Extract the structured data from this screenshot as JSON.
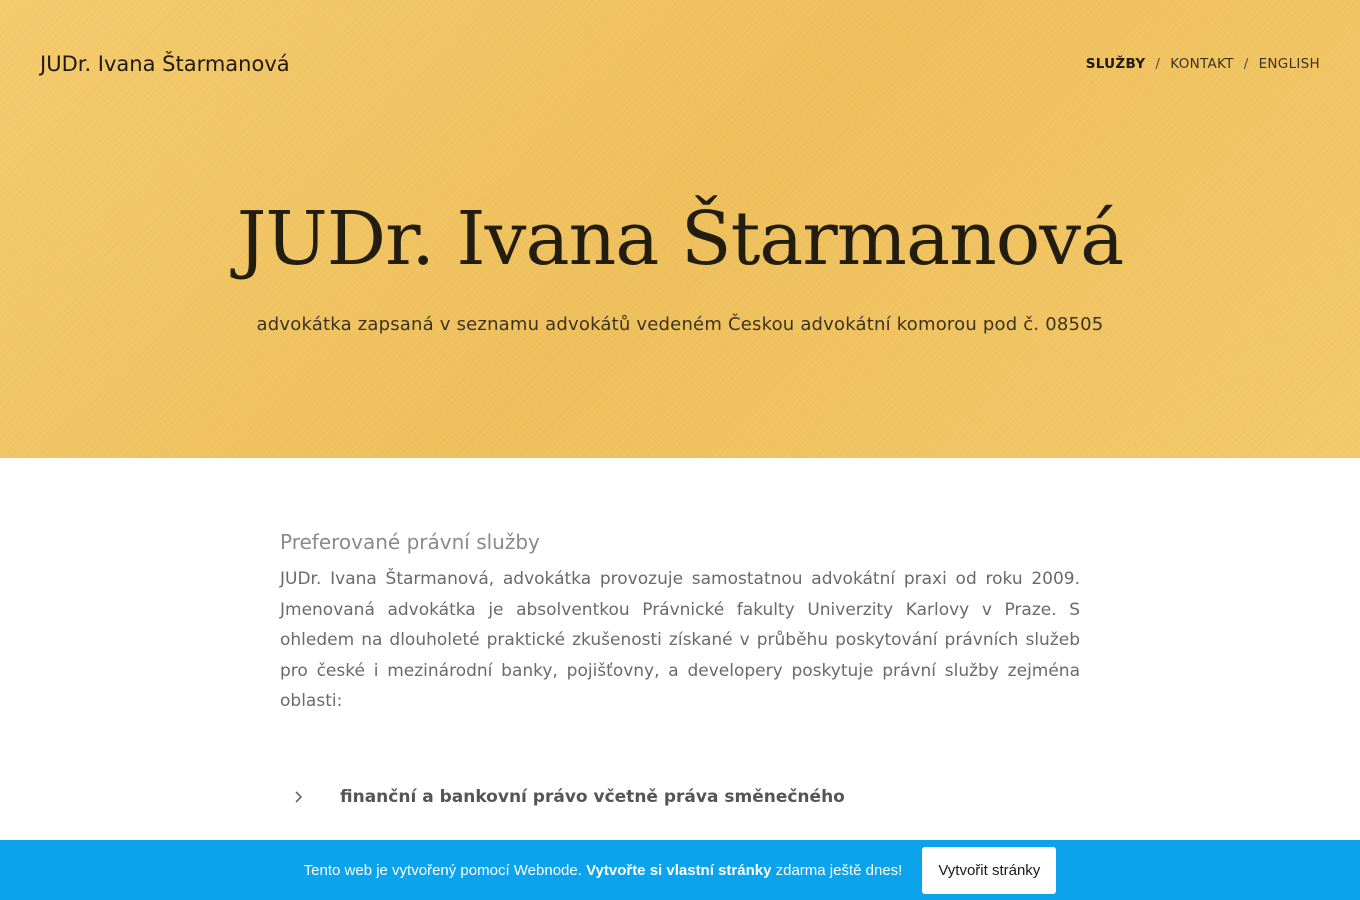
{
  "header": {
    "brand": "JUDr. Ivana Štarmanová",
    "nav": [
      {
        "label": "SLUŽBY",
        "active": true
      },
      {
        "label": "KONTAKT",
        "active": false
      },
      {
        "label": "ENGLISH",
        "active": false
      }
    ],
    "separator": "/"
  },
  "hero": {
    "title": "JUDr. Ivana Štarmanová",
    "subtitle": "advokátka zapsaná v seznamu advokátů vedeném Českou advokátní komorou pod č. 08505",
    "background_color": "#f0c461"
  },
  "main": {
    "section_title": "Preferované právní služby",
    "section_text": "JUDr. Ivana Štarmanová, advokátka provozuje samostatnou advokátní praxi od roku 2009. Jmenovaná advokátka je absolventkou Právnické fakulty Univerzity Karlovy v Praze. S ohledem na dlouholeté praktické zkušenosti získané v průběhu poskytování právních služeb pro české i mezinárodní banky, pojišťovny, a developery poskytuje právní služby zejména oblasti:",
    "services": [
      {
        "icon": "chevron-right-icon",
        "label": "finanční a bankovní právo včetně práva směnečného"
      }
    ]
  },
  "banner": {
    "text_before": "Tento web je vytvořený pomocí Webnode.",
    "text_bold": "Vytvořte si vlastní stránky",
    "text_after": "zdarma ještě dnes!",
    "button_label": "Vytvořit stránky",
    "background_color": "#0ba3ec"
  }
}
